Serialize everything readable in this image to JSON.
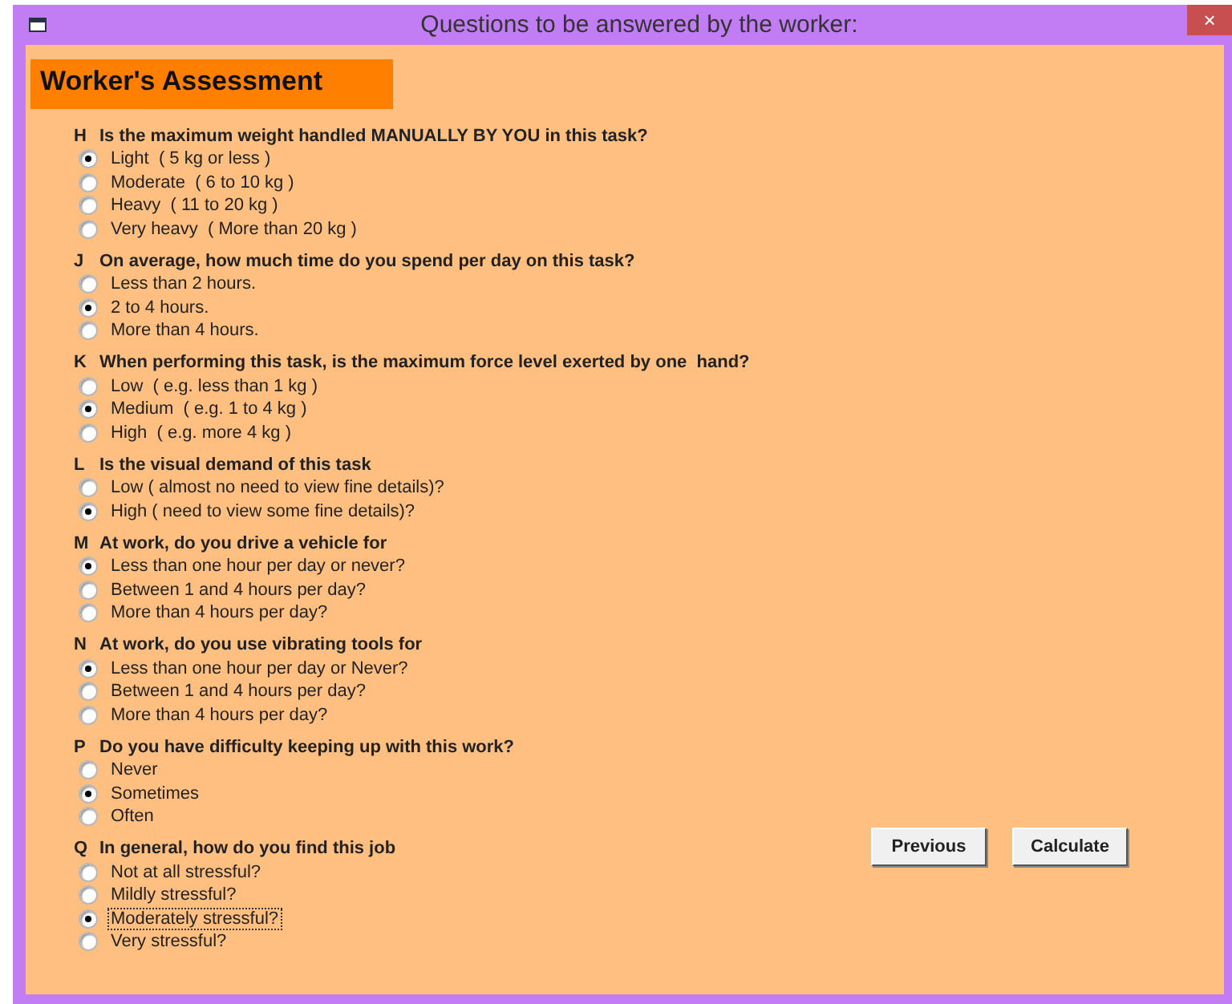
{
  "window": {
    "title": "Questions to be answered by the worker:",
    "close": "×"
  },
  "heading": "Worker's Assessment",
  "questions": [
    {
      "letter": "H",
      "text": "Is the maximum weight handled MANUALLY BY YOU in this task?",
      "options": [
        {
          "label": "Light  ( 5 kg or less )",
          "selected": true
        },
        {
          "label": "Moderate  ( 6 to 10 kg )",
          "selected": false
        },
        {
          "label": "Heavy  ( 11 to 20 kg )",
          "selected": false
        },
        {
          "label": "Very heavy  ( More than 20 kg )",
          "selected": false
        }
      ]
    },
    {
      "letter": "J",
      "text": "On average, how much time do you spend per day on this task?",
      "options": [
        {
          "label": "Less than 2 hours.",
          "selected": false
        },
        {
          "label": "2 to 4 hours.",
          "selected": true
        },
        {
          "label": "More than 4 hours.",
          "selected": false
        }
      ]
    },
    {
      "letter": "K",
      "text": "When performing this task, is the maximum force level exerted by one  hand?",
      "options": [
        {
          "label": "Low  ( e.g. less than 1 kg )",
          "selected": false
        },
        {
          "label": "Medium  ( e.g. 1 to 4 kg )",
          "selected": true
        },
        {
          "label": "High  ( e.g. more 4 kg )",
          "selected": false
        }
      ]
    },
    {
      "letter": "L",
      "text": "Is the visual demand of this task",
      "options": [
        {
          "label": "Low ( almost no need to view fine details)?",
          "selected": false
        },
        {
          "label": "High ( need to view some fine details)?",
          "selected": true
        }
      ]
    },
    {
      "letter": "M",
      "text": "At work, do you drive a vehicle for",
      "options": [
        {
          "label": "Less than one hour per day or never?",
          "selected": true
        },
        {
          "label": "Between 1 and 4 hours per day?",
          "selected": false
        },
        {
          "label": "More than 4 hours per day?",
          "selected": false
        }
      ]
    },
    {
      "letter": "N",
      "text": "At work, do you use vibrating tools for",
      "options": [
        {
          "label": "Less than one hour per day or Never?",
          "selected": true
        },
        {
          "label": "Between 1 and 4 hours per day?",
          "selected": false
        },
        {
          "label": "More than 4 hours per day?",
          "selected": false
        }
      ]
    },
    {
      "letter": "P",
      "text": "Do you have difficulty keeping up with this work?",
      "options": [
        {
          "label": "Never",
          "selected": false
        },
        {
          "label": "Sometimes",
          "selected": true
        },
        {
          "label": "Often",
          "selected": false
        }
      ]
    },
    {
      "letter": "Q",
      "text": "In general, how do you find this job",
      "options": [
        {
          "label": "Not at all stressful?",
          "selected": false,
          "focused": false
        },
        {
          "label": "Mildly stressful?",
          "selected": false,
          "focused": false
        },
        {
          "label": "Moderately stressful?",
          "selected": true,
          "focused": true
        },
        {
          "label": "Very stressful?",
          "selected": false,
          "focused": false
        }
      ]
    }
  ],
  "buttons": [
    {
      "label": "Previous"
    },
    {
      "label": "Calculate"
    }
  ]
}
